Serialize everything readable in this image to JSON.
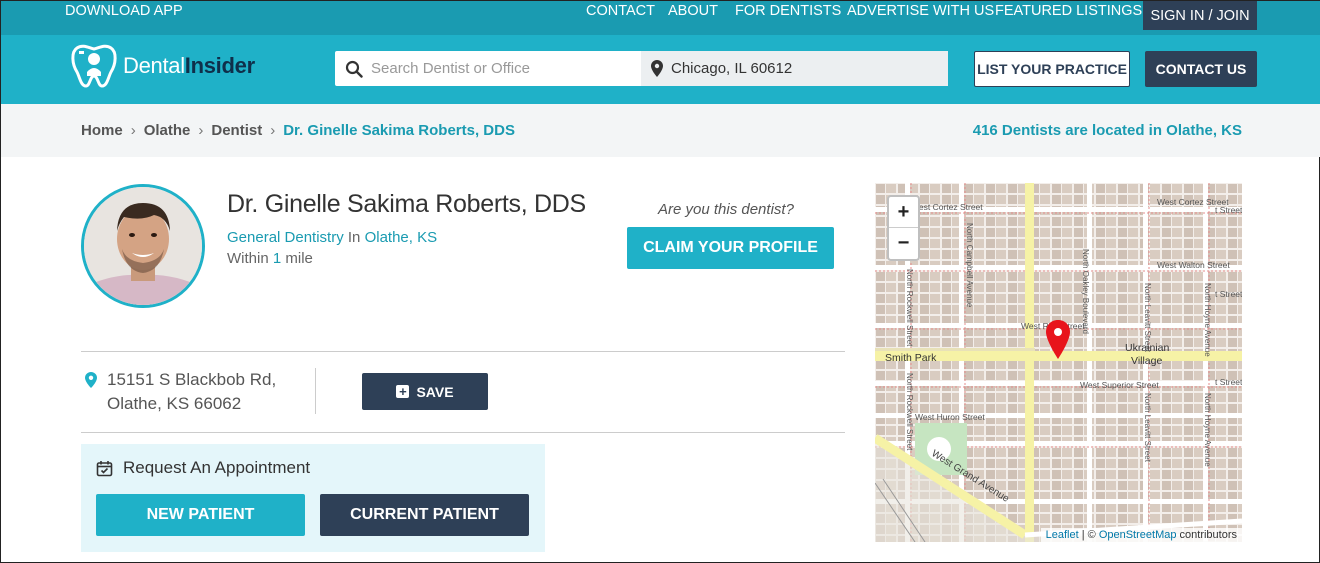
{
  "topbar": {
    "download": "DOWNLOAD APP",
    "nav": [
      "CONTACT",
      "ABOUT",
      "FOR DENTISTS",
      "ADVERTISE WITH US",
      "FEATURED LISTINGS"
    ],
    "signin": "SIGN IN / JOIN"
  },
  "header": {
    "logo_dental": "Dental",
    "logo_insider": "Insider",
    "search_placeholder": "Search Dentist or Office",
    "location_value": "Chicago, IL 60612",
    "list_practice": "LIST YOUR PRACTICE",
    "contact_us": "CONTACT US"
  },
  "breadcrumb": {
    "items": [
      "Home",
      "Olathe",
      "Dentist"
    ],
    "current": "Dr. Ginelle Sakima Roberts, DDS",
    "count_text": "416 Dentists are located in Olathe, KS"
  },
  "profile": {
    "name": "Dr. Ginelle Sakima Roberts, DDS",
    "specialty": "General Dentistry",
    "in_word": "In",
    "city": "Olathe, KS",
    "within_prefix": "Within",
    "within_num": "1",
    "within_unit": "mile",
    "claim_question": "Are you this dentist?",
    "claim_button": "CLAIM YOUR PROFILE",
    "address_line1": "15151 S Blackbob Rd,",
    "address_line2": "Olathe, KS 66062",
    "save_button": "SAVE"
  },
  "appointment": {
    "title": "Request An Appointment",
    "new_patient": "NEW PATIENT",
    "current_patient": "CURRENT PATIENT"
  },
  "map": {
    "zoom_in": "+",
    "zoom_out": "−",
    "attrib_leaflet": "Leaflet",
    "attrib_sep": " | © ",
    "attrib_osm": "OpenStreetMap",
    "attrib_contrib": " contributors",
    "labels": {
      "cortez_left": "West Cortez Street",
      "cortez_right": "West Cortez Street",
      "walton": "West Walton Street",
      "rice": "West Rice Street",
      "superior": "West Superior Street",
      "huron": "West Huron Street",
      "grand": "West Grand Avenue",
      "smith_park": "Smith Park",
      "ukrainian": "Ukrainian",
      "village": "Village",
      "campbell": "North Campbell Avenue",
      "oakley": "North Oakley Boulevard",
      "leavitt": "North Leavitt Street",
      "hoyne": "North Hoyne Avenue",
      "rockwell": "North Rockwell Street",
      "street_a": "t Street",
      "street_b": "t Street",
      "street_c": "t Street"
    },
    "pin_color": "#e8141c"
  },
  "colors": {
    "primary": "#1fb1c8",
    "topbar": "#1a9bb1",
    "navy": "#2e4057"
  }
}
